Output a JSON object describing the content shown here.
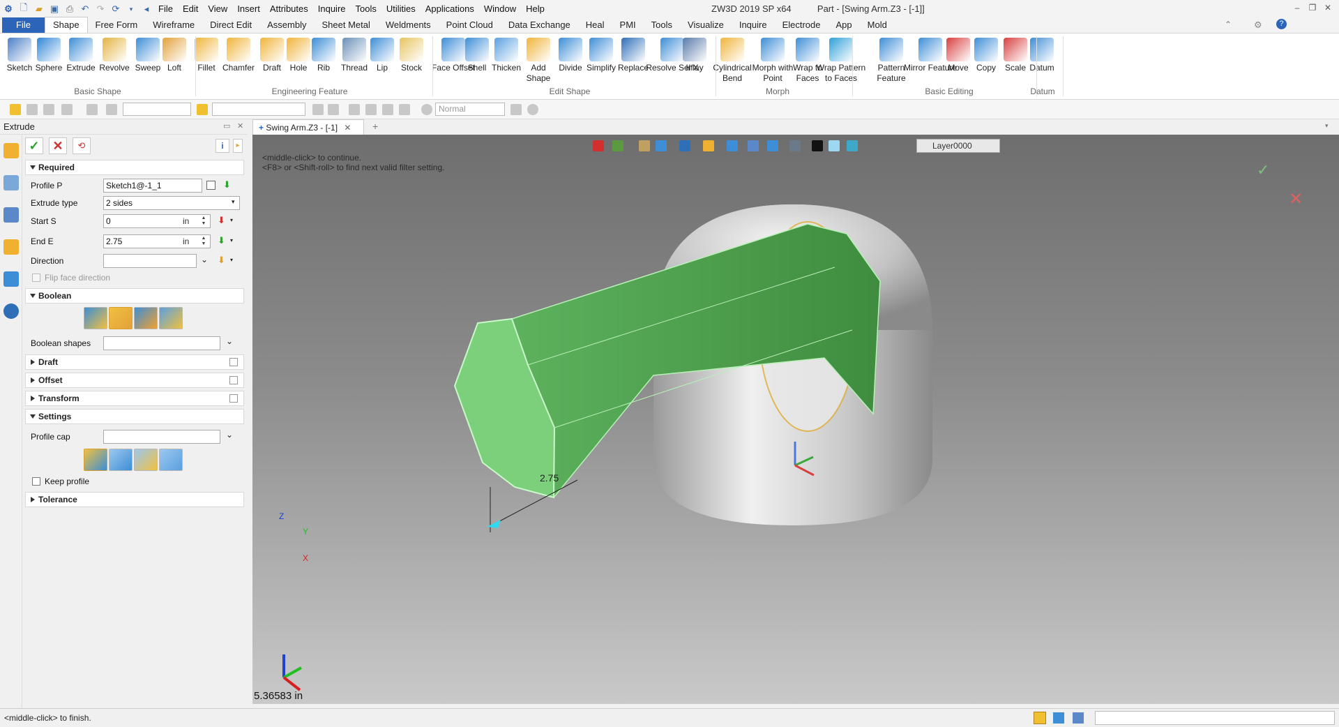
{
  "title_bar": {
    "menu": [
      "File",
      "Edit",
      "View",
      "Insert",
      "Attributes",
      "Inquire",
      "Tools",
      "Utilities",
      "Applications",
      "Window",
      "Help"
    ],
    "app_title": "ZW3D 2019 SP x64",
    "doc_title": "Part - [Swing Arm.Z3 - [-1]]"
  },
  "ribbon_tabs": [
    "File",
    "Shape",
    "Free Form",
    "Wireframe",
    "Direct Edit",
    "Assembly",
    "Sheet Metal",
    "Weldments",
    "Point Cloud",
    "Data Exchange",
    "Heal",
    "PMI",
    "Tools",
    "Visualize",
    "Inquire",
    "Electrode",
    "App",
    "Mold"
  ],
  "ribbon": {
    "buttons": [
      {
        "label": "Sketch",
        "color": "#4a7fc7"
      },
      {
        "label": "Sphere",
        "color": "#2f86d6"
      },
      {
        "label": "Extrude",
        "color": "#3d8ed6"
      },
      {
        "label": "Revolve",
        "color": "#e3b341"
      },
      {
        "label": "Sweep",
        "color": "#3d8ed6"
      },
      {
        "label": "Loft",
        "color": "#e3a13a"
      },
      {
        "label": "Fillet",
        "color": "#f0b43a"
      },
      {
        "label": "Chamfer",
        "color": "#f0b43a"
      },
      {
        "label": "Draft",
        "color": "#f0b43a"
      },
      {
        "label": "Hole",
        "color": "#f0b43a"
      },
      {
        "label": "Rib",
        "color": "#3d8ed6"
      },
      {
        "label": "Thread",
        "color": "#6a8fb8"
      },
      {
        "label": "Lip",
        "color": "#3d8ed6"
      },
      {
        "label": "Stock",
        "color": "#e8c560"
      },
      {
        "label": "Face Offset",
        "color": "#3d8ed6"
      },
      {
        "label": "Shell",
        "color": "#3d8ed6"
      },
      {
        "label": "Thicken",
        "color": "#5aa0e0"
      },
      {
        "label": "Add Shape",
        "color": "#f0b43a"
      },
      {
        "label": "Divide",
        "color": "#3d8ed6"
      },
      {
        "label": "Simplify",
        "color": "#3d8ed6"
      },
      {
        "label": "Replace",
        "color": "#2f6fb8"
      },
      {
        "label": "Resolve SelfX",
        "color": "#3d8ed6"
      },
      {
        "label": "Inlay",
        "color": "#5a7aa8"
      },
      {
        "label": "Cylindrical Bend",
        "color": "#f0b43a"
      },
      {
        "label": "Morph with Point",
        "color": "#3d8ed6"
      },
      {
        "label": "Wrap to Faces",
        "color": "#3d8ed6"
      },
      {
        "label": "Wrap Pattern to Faces",
        "color": "#2fa0d8"
      },
      {
        "label": "Pattern Feature",
        "color": "#3d8ed6"
      },
      {
        "label": "Mirror Feature",
        "color": "#3d8ed6"
      },
      {
        "label": "Move",
        "color": "#d84040"
      },
      {
        "label": "Copy",
        "color": "#3d8ed6"
      },
      {
        "label": "Scale",
        "color": "#d84040"
      },
      {
        "label": "Datum",
        "color": "#3d8ed6"
      }
    ],
    "groups": [
      "Basic Shape",
      "Engineering Feature",
      "Edit Shape",
      "Morph",
      "Basic Editing",
      "Datum"
    ]
  },
  "toolbar2": {
    "mode": "Normal",
    "layer": "Layer0000"
  },
  "panel": {
    "title": "Extrude",
    "sections": {
      "required": "Required",
      "boolean": "Boolean",
      "draft": "Draft",
      "offset": "Offset",
      "transform": "Transform",
      "settings": "Settings",
      "tolerance": "Tolerance"
    },
    "fields": {
      "profile_label": "Profile P",
      "profile_value": "Sketch1@-1_1",
      "extrude_type_label": "Extrude type",
      "extrude_type_value": "2 sides",
      "start_label": "Start S",
      "start_value": "0",
      "end_label": "End E",
      "end_value": "2.75",
      "unit": "in",
      "direction_label": "Direction",
      "flip_label": "Flip face direction",
      "boolean_shapes_label": "Boolean shapes",
      "profile_cap_label": "Profile cap",
      "keep_profile_label": "Keep profile"
    }
  },
  "doc_tab": "Swing Arm.Z3 - [-1]",
  "viewport": {
    "prompt_line1": "<middle-click> to continue.",
    "prompt_line2": "<F8> or <Shift-roll> to find next valid filter setting.",
    "dimension": "2.75",
    "readout": "5.36583 in",
    "axis_x": "X",
    "axis_y": "Y",
    "axis_z": "Z"
  },
  "status": {
    "message": "<middle-click> to finish."
  },
  "colors": {
    "accent": "#2b64b8",
    "extrude_preview": "#7cd07c",
    "confirm": "#2aa52a",
    "cancel": "#d32f2f"
  }
}
